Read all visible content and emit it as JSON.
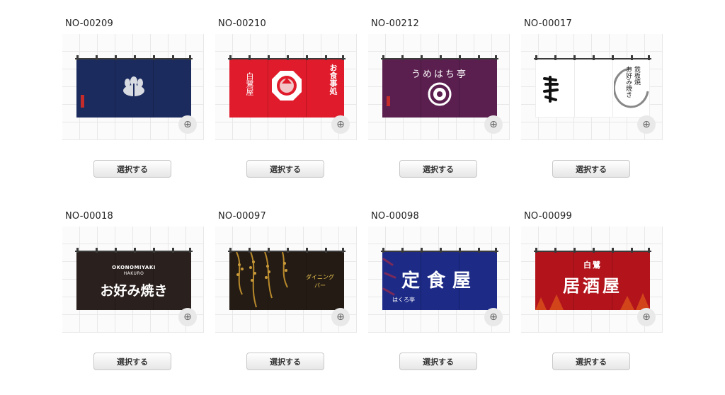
{
  "items": [
    {
      "code": "NO-00209",
      "button": "選択する",
      "texts": []
    },
    {
      "code": "NO-00210",
      "button": "選択する",
      "texts": [
        "白鷺屋",
        "お食事処"
      ]
    },
    {
      "code": "NO-00212",
      "button": "選択する",
      "texts": [
        "うめはち亭"
      ]
    },
    {
      "code": "NO-00017",
      "button": "選択する",
      "texts": [
        "鉄板焼",
        "お好み焼き"
      ]
    },
    {
      "code": "NO-00018",
      "button": "選択する",
      "texts": [
        "OKONOMIYAKI",
        "HAKURO",
        "お好み焼き"
      ]
    },
    {
      "code": "NO-00097",
      "button": "選択する",
      "texts": [
        "ダイニング",
        "バー"
      ]
    },
    {
      "code": "NO-00098",
      "button": "選択する",
      "texts": [
        "定食屋",
        "はくろ亭"
      ]
    },
    {
      "code": "NO-00099",
      "button": "選択する",
      "texts": [
        "白鷺",
        "居酒屋"
      ]
    }
  ],
  "colors": {
    "navy": "#1b2b5e",
    "red": "#e01b2b",
    "plum": "#5a1f4f",
    "white": "#ffffff",
    "black": "#2a201d",
    "darkgold": "#241c14",
    "blue": "#1d2a86",
    "crimson": "#b3141c"
  }
}
